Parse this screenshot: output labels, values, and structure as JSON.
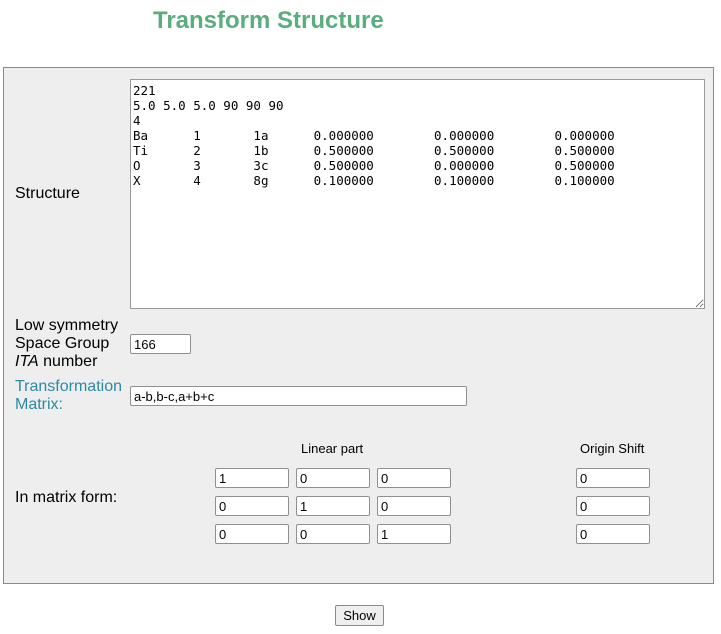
{
  "page": {
    "title": "Transform Structure"
  },
  "form": {
    "structure_label": "Structure",
    "structure_value": "221\n5.0 5.0 5.0 90 90 90\n4\nBa\t1\t1a\t0.000000\t0.000000\t0.000000\nTi\t2\t1b\t0.500000\t0.500000\t0.500000\nO\t3\t3c\t0.500000\t0.000000\t0.500000\nX\t4\t8g\t0.100000\t0.100000\t0.100000",
    "space_group_label_line1": "Low symmetry",
    "space_group_label_line2": "Space Group",
    "space_group_label_ita": "ITA",
    "space_group_label_suffix": " number",
    "space_group_value": "166",
    "transformation_label_line1": "Transformation",
    "transformation_label_line2": "Matrix:",
    "transformation_value": "a-b,b-c,a+b+c",
    "matrix_form_label": "In matrix form:",
    "linear_part_header": "Linear part",
    "origin_shift_header": "Origin Shift",
    "linear_part": [
      [
        "1",
        "0",
        "0"
      ],
      [
        "0",
        "1",
        "0"
      ],
      [
        "0",
        "0",
        "1"
      ]
    ],
    "origin_shift": [
      "0",
      "0",
      "0"
    ]
  },
  "actions": {
    "show_label": "Show"
  }
}
